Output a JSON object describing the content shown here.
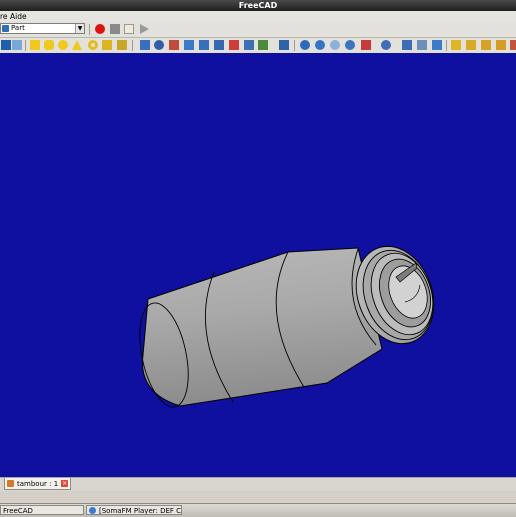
{
  "window": {
    "title": "FreeCAD"
  },
  "menubar": {
    "items": [
      "re",
      "Aide"
    ]
  },
  "workbench": {
    "selected": "Part"
  },
  "macro_toolbar": {
    "icons": [
      "record-macro-icon",
      "stop-macro-icon",
      "edit-macro-icon",
      "run-macro-icon"
    ]
  },
  "part_toolbar": {
    "icons": [
      "part-box-icon",
      "part-cylinder-icon",
      "part-sphere-icon",
      "part-cone-icon",
      "part-torus-icon",
      "part-primitives-icon",
      "part-shape-builder-icon",
      "part-extrude-icon",
      "part-revolve-icon",
      "part-mirror-icon",
      "part-fillet-icon",
      "part-chamfer-icon",
      "part-ruled-surface-icon",
      "part-loft-icon",
      "part-sweep-icon",
      "part-section-icon",
      "part-boolean-icon",
      "part-cut-icon",
      "part-fuse-icon",
      "part-common-icon",
      "part-compound-icon",
      "part-check-geometry-icon",
      "part-cross-sections-icon",
      "part-offset-icon",
      "part-thickness-icon",
      "part-measure-icon"
    ]
  },
  "colors": {
    "viewport_background": "#1010a0",
    "title_bar": "#2a2a2a",
    "model_shade": "#bdbdbd"
  },
  "document_tab": {
    "label": "tambour : 1"
  },
  "taskbar": {
    "items": [
      {
        "label": "FreeCAD"
      },
      {
        "label": "[SomaFM Player: DEF C..."
      }
    ]
  }
}
